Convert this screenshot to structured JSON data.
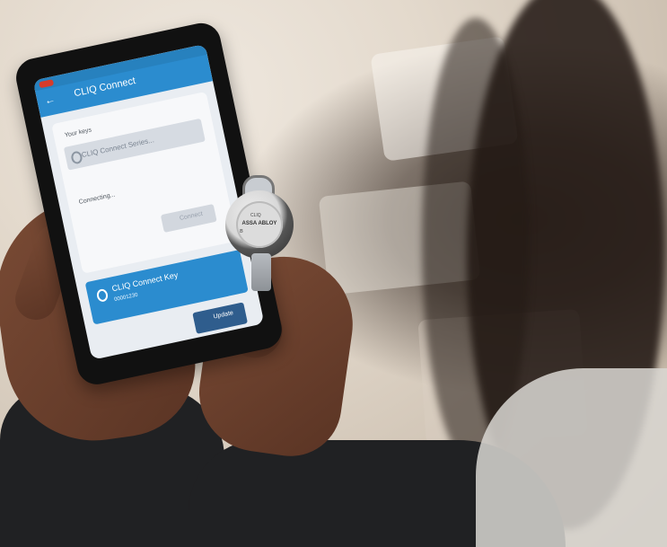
{
  "phone_app": {
    "title": "CLIQ Connect",
    "section_label": "Your keys",
    "selected_key_label": "CLIQ Connect Series...",
    "status_text": "Connecting...",
    "connect_button": "Connect",
    "key_card_title": "CLIQ Connect Key",
    "key_card_subtitle": "00001230",
    "update_button": "Update"
  },
  "fob": {
    "brand": "ASSA ABLOY",
    "small_text": "CLIQ"
  },
  "colors": {
    "app_blue": "#2b8ccf",
    "dark_blue": "#2f5d8d",
    "jacket": "#202123",
    "skin": "#6e4330"
  }
}
